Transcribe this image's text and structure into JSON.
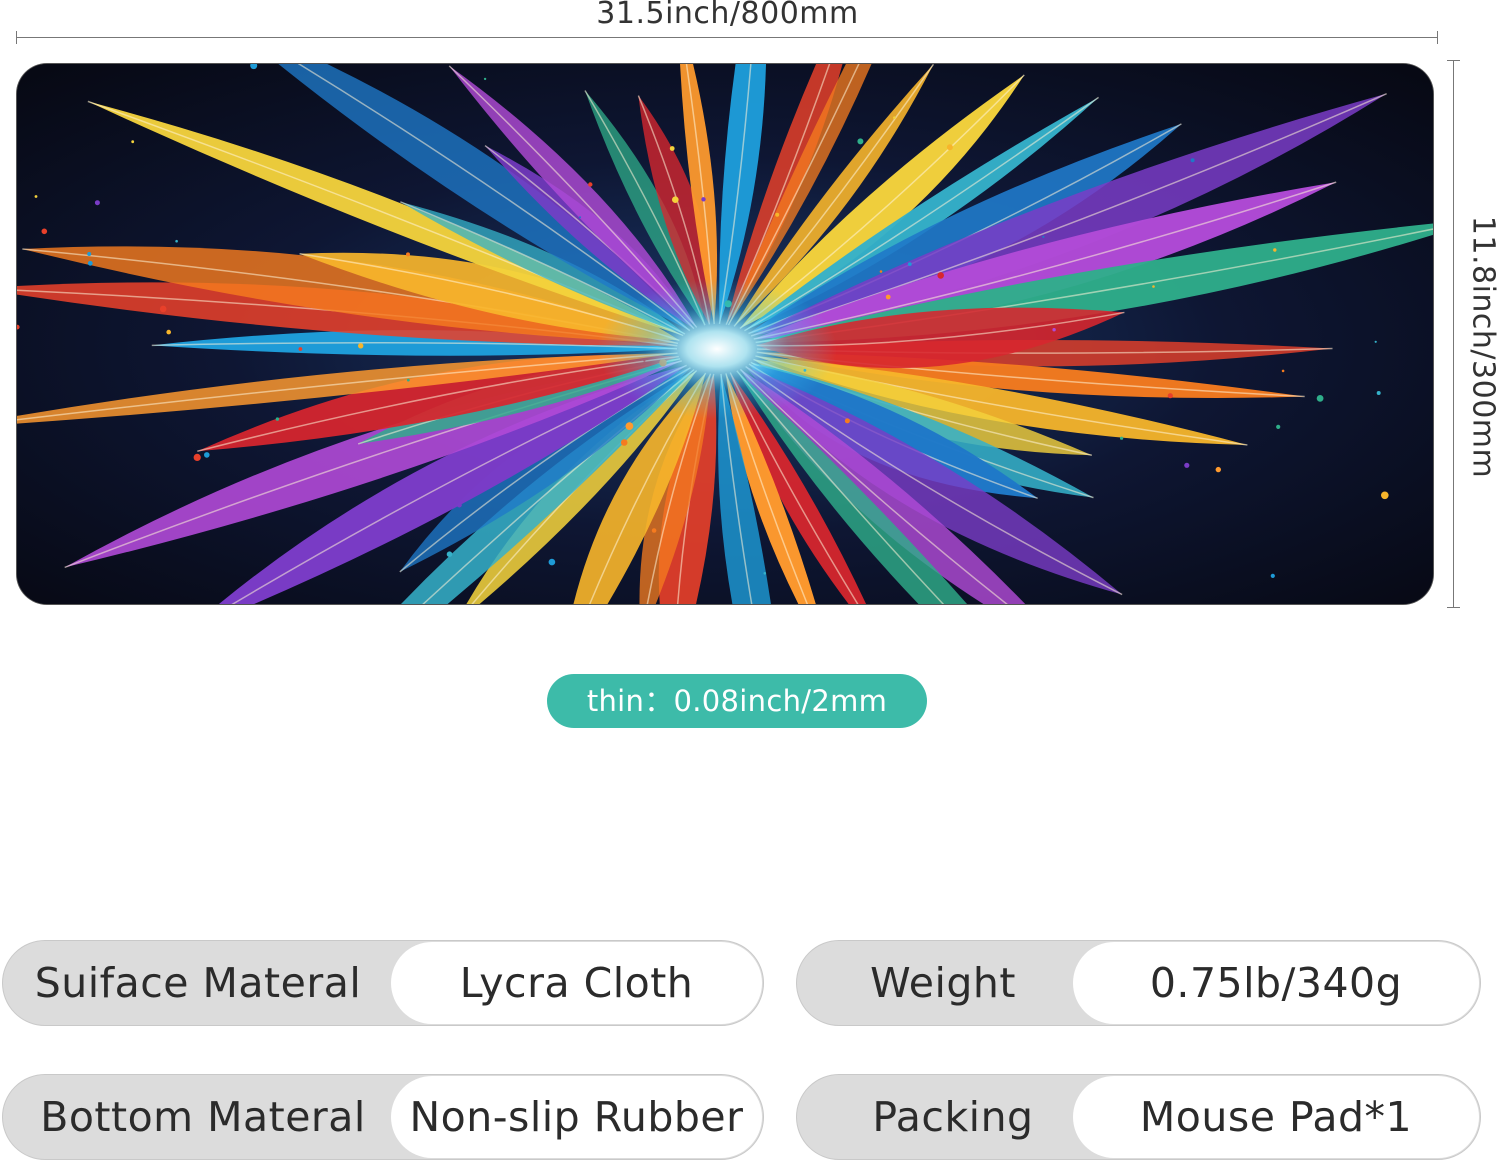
{
  "dimensions": {
    "width_label": "31.5inch/800mm",
    "height_label": "11.8inch/300mm"
  },
  "thickness": {
    "label": "thin：0.08inch/2mm",
    "color": "#3dbba9"
  },
  "product_image": {
    "icon": "feather-artwork-mousepad"
  },
  "specs": {
    "surface": {
      "label": "Suiface Materal",
      "value": "Lycra Cloth"
    },
    "bottom": {
      "label": "Bottom Materal",
      "value": "Non-slip Rubber"
    },
    "weight": {
      "label": "Weight",
      "value": "0.75lb/340g"
    },
    "packing": {
      "label": "Packing",
      "value": "Mouse Pad*1"
    }
  }
}
